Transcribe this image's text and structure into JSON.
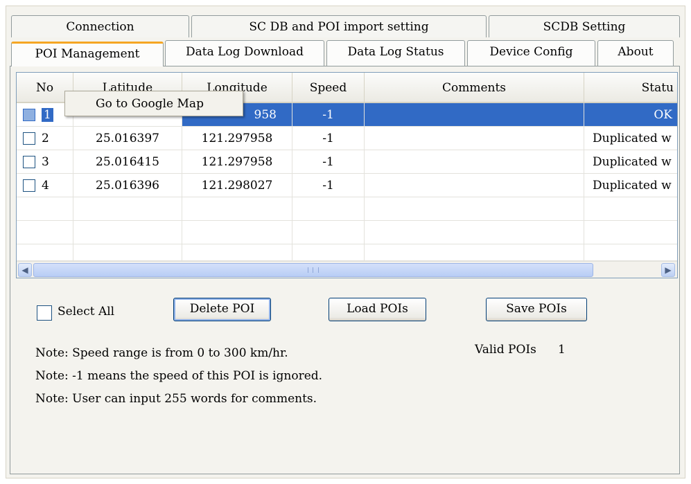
{
  "tabs": {
    "back_row": [
      "Connection",
      "SC DB and POI import setting",
      "SCDB  Setting"
    ],
    "front_row": [
      "POI Management",
      "Data Log Download",
      "Data Log Status",
      "Device Config",
      "About"
    ],
    "active": "POI Management"
  },
  "grid": {
    "columns": [
      "No",
      "Latitude",
      "Longitude",
      "Speed",
      "Comments",
      "Statu"
    ],
    "rows": [
      {
        "no": "1",
        "latitude": "",
        "longitude": "958",
        "speed": "-1",
        "comments": "",
        "status": "OK",
        "selected": true
      },
      {
        "no": "2",
        "latitude": "25.016397",
        "longitude": "121.297958",
        "speed": "-1",
        "comments": "",
        "status": "Duplicated w",
        "selected": false
      },
      {
        "no": "3",
        "latitude": "25.016415",
        "longitude": "121.297958",
        "speed": "-1",
        "comments": "",
        "status": "Duplicated w",
        "selected": false
      },
      {
        "no": "4",
        "latitude": "25.016396",
        "longitude": "121.298027",
        "speed": "-1",
        "comments": "",
        "status": "Duplicated w",
        "selected": false
      }
    ]
  },
  "context_menu": {
    "item": "Go to Google Map"
  },
  "controls": {
    "select_all": "Select All",
    "delete_poi": "Delete POI",
    "load_pois": "Load POIs",
    "save_pois": "Save POIs",
    "valid_pois_label": "Valid POIs",
    "valid_pois_value": "1"
  },
  "notes": [
    "Note: Speed range is from 0 to 300 km/hr.",
    "Note: -1 means the speed of this POI is ignored.",
    "Note:  User can input 255 words for comments."
  ],
  "colors": {
    "selection": "#316ac5",
    "active_tab_accent": "#f5a623",
    "button_border": "#003c74"
  }
}
